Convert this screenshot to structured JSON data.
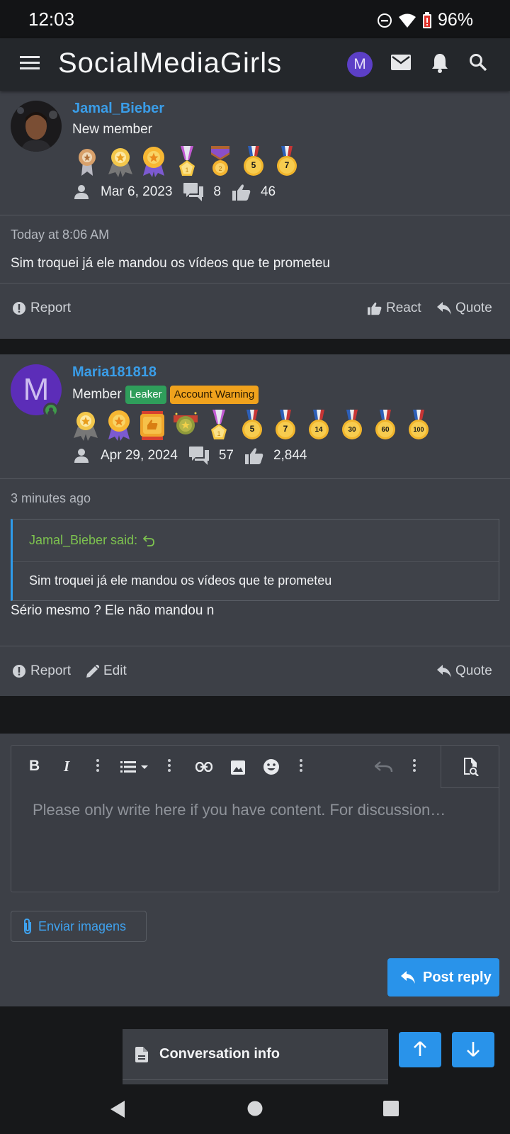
{
  "status_bar": {
    "time": "12:03",
    "battery": "96%"
  },
  "header": {
    "title": "SocialMediaGirls",
    "avatar_letter": "M"
  },
  "posts": [
    {
      "username": "Jamal_Bieber",
      "user_title": "New member",
      "joined": "Mar 6, 2023",
      "messages": "8",
      "reactions": "46",
      "time": "Today at 8:06 AM",
      "text": "Sim troquei já ele mandou os vídeos que te prometeu",
      "trophy_labels": [
        "",
        "",
        "",
        "",
        "",
        "5",
        "7"
      ],
      "actions": {
        "report": "Report",
        "react": "React",
        "quote": "Quote"
      }
    },
    {
      "username": "Maria181818",
      "avatar_letter": "M",
      "user_title": "Member",
      "badges": [
        "Leaker",
        "Account Warning"
      ],
      "joined": "Apr 29, 2024",
      "messages": "57",
      "reactions": "2,844",
      "time": "3 minutes ago",
      "quote": {
        "author": "Jamal_Bieber said:",
        "text": "Sim troquei já ele mandou os vídeos que te prometeu"
      },
      "text": "Sério mesmo ? Ele não mandou n",
      "trophy_labels": [
        "",
        "",
        "",
        "",
        "",
        "5",
        "7",
        "14",
        "30",
        "60",
        "100"
      ],
      "actions": {
        "report": "Report",
        "edit": "Edit",
        "quote": "Quote"
      }
    }
  ],
  "editor": {
    "placeholder": "Please only write here if you have content. For discussion…",
    "bold": "B",
    "italic": "I",
    "attach_label": "Enviar imagens",
    "submit_label": "Post reply"
  },
  "bottom": {
    "conversation_info": "Conversation info"
  },
  "colors": {
    "accent": "#2993ea",
    "link": "#3a9de8",
    "quote_author": "#7dc24f",
    "leaker": "#2f9e5b",
    "warning": "#f0a21d"
  }
}
